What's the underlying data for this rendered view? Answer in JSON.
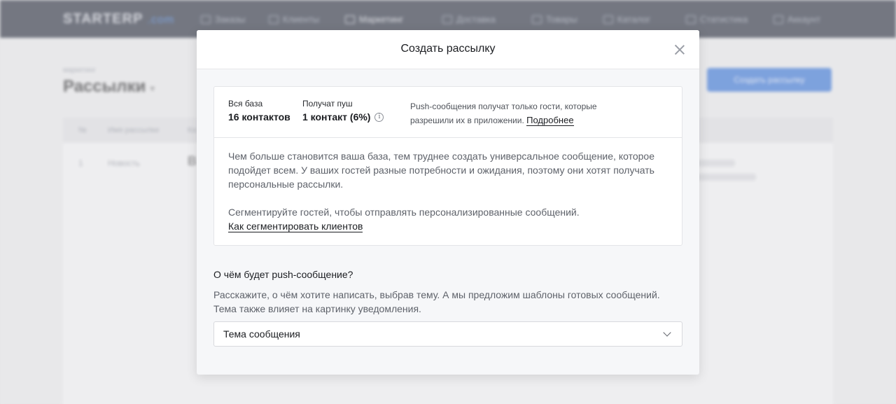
{
  "background": {
    "logo": "STARTERP",
    "logo_suffix": ".com",
    "nav": [
      "Заказы",
      "Клиенты",
      "Маркетинг",
      "Доставка",
      "Товары",
      "Каталог",
      "Статистика",
      "Аккаунт"
    ],
    "breadcrumb": "маркетинг",
    "page_title": "Рассылки",
    "create_button": "Создать рассылку",
    "table_headers": [
      "№",
      "Имя рассылки",
      "Ка"
    ],
    "row": {
      "id": "1",
      "name": "Новость",
      "initial": "В"
    }
  },
  "modal": {
    "title": "Создать рассылку",
    "stats": {
      "total_label": "Вся база",
      "total_value": "16 контактов",
      "push_label": "Получат пуш",
      "push_value": "1 контакт (6%)",
      "note": "Push-сообщения получат только гости, которые разрешили их в приложении.",
      "note_link": "Подробнее"
    },
    "body_text": "Чем больше становится ваша база, тем труднее создать универсальное сообщение, которое подойдет всем. У ваших гостей разные потребности и ожидания, поэтому они хотят получать персональные рассылки.",
    "segment_text": "Сегментируйте гостей, чтобы отправлять персонализированные сообщений.",
    "segment_link": "Как сегментировать клиентов",
    "question": "О чём будет push-сообщение?",
    "question_desc": "Расскажите, о чём хотите написать, выбрав тему. А мы предложим шаблоны готовых сообщений. Тема также влияет на картинку уведомления.",
    "select_placeholder": "Тема сообщения"
  }
}
